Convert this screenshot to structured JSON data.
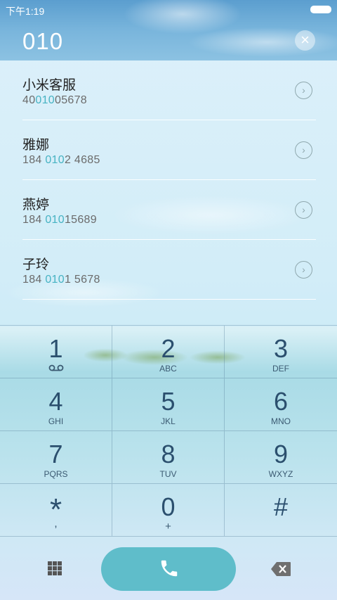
{
  "status_bar": {
    "time": "下午1:19"
  },
  "search": {
    "number": "010"
  },
  "contacts": [
    {
      "name": "小米客服",
      "number_before": "40",
      "number_match": "010",
      "number_after": "05678"
    },
    {
      "name": "雅娜",
      "number_before": "184 ",
      "number_match": "010",
      "number_after": "2 4685"
    },
    {
      "name": "燕婷",
      "number_before": "184 ",
      "number_match": "010",
      "number_after": "15689"
    },
    {
      "name": "子玲",
      "number_before": "184 ",
      "number_match": "010",
      "number_after": "1 5678"
    }
  ],
  "keypad": [
    {
      "digit": "1",
      "sub": "",
      "icon": "voicemail-icon"
    },
    {
      "digit": "2",
      "sub": "ABC"
    },
    {
      "digit": "3",
      "sub": "DEF"
    },
    {
      "digit": "4",
      "sub": "GHI"
    },
    {
      "digit": "5",
      "sub": "JKL"
    },
    {
      "digit": "6",
      "sub": "MNO"
    },
    {
      "digit": "7",
      "sub": "PQRS"
    },
    {
      "digit": "8",
      "sub": "TUV"
    },
    {
      "digit": "9",
      "sub": "WXYZ"
    },
    {
      "digit": "*",
      "sub": ","
    },
    {
      "digit": "0",
      "sub": "+"
    },
    {
      "digit": "#",
      "sub": ""
    }
  ],
  "colors": {
    "accent": "#5fbdca",
    "match_highlight": "#47b3c3",
    "key_text": "#2b4f6e"
  },
  "icons": {
    "clear": "close-icon",
    "call": "phone-icon",
    "dialpad": "dialpad-grid-icon",
    "backspace": "backspace-icon",
    "detail": "chevron-right-icon"
  }
}
